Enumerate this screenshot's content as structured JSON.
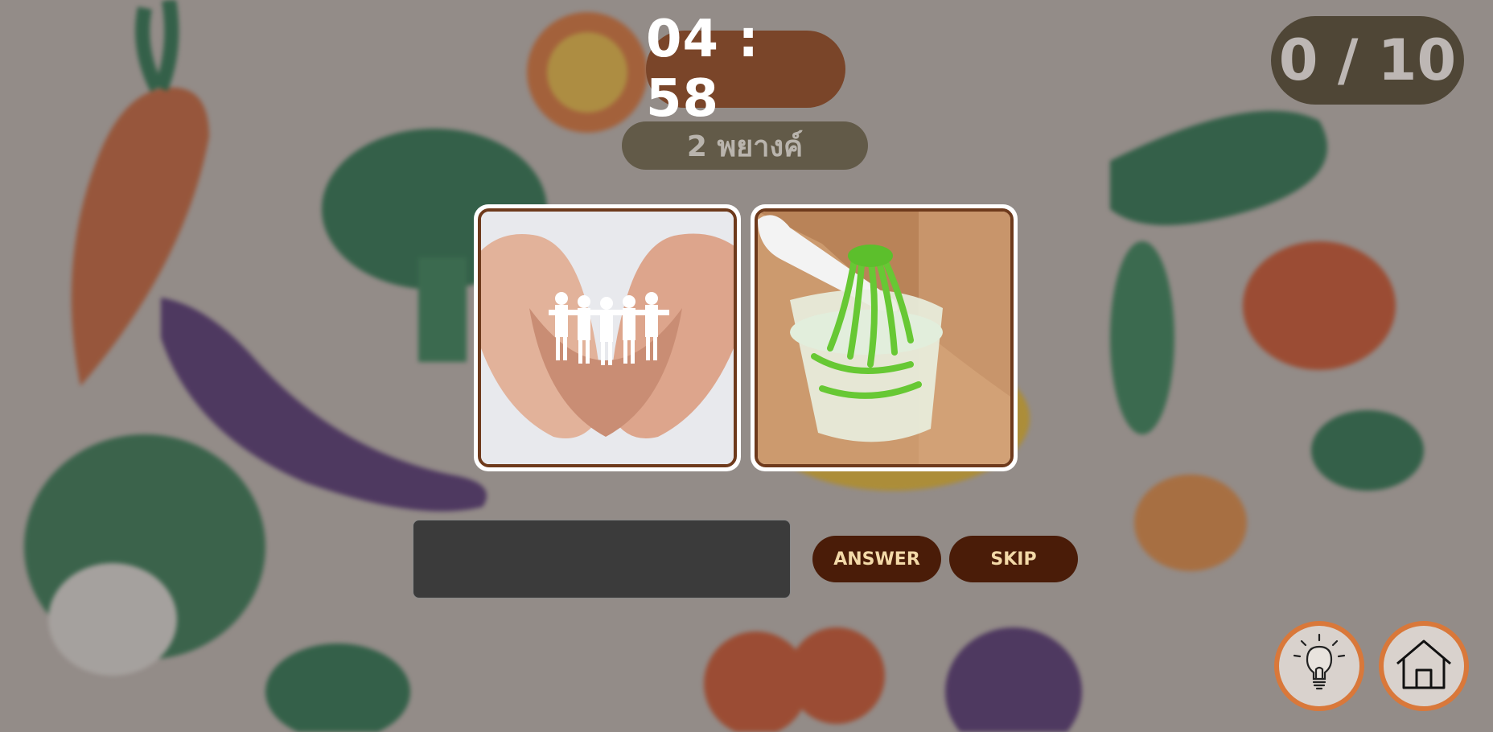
{
  "game": {
    "timer": "04 : 58",
    "syllable_hint": "2 พยางค์",
    "score": "0 / 10"
  },
  "clues": [
    {
      "name": "picture-1",
      "icon": "hands-holding-paper-people"
    },
    {
      "name": "picture-2",
      "icon": "green-noodle-dessert-in-coconut-milk"
    }
  ],
  "answer_input": {
    "value": "",
    "placeholder": ""
  },
  "buttons": {
    "answer_label": "ANSWER",
    "skip_label": "SKIP",
    "hint_icon": "lightbulb-icon",
    "home_icon": "home-icon"
  },
  "colors": {
    "timer_bg": "#7a4529",
    "button_bg": "#4a1c08",
    "button_text": "#f3d9a8",
    "round_border": "#d9783a"
  }
}
